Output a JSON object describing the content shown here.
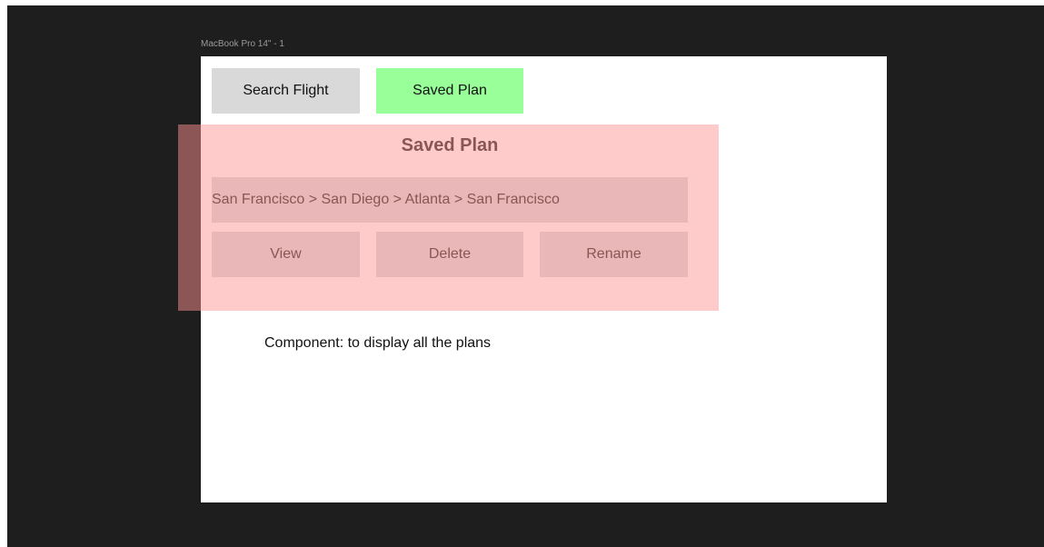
{
  "canvas": {
    "frame_label": "MacBook Pro 14\" - 1"
  },
  "nav": {
    "search_flight_label": "Search Flight",
    "saved_plan_label": "Saved Plan"
  },
  "saved_plan_panel": {
    "title": "Saved Plan",
    "route": "San Francisco > San Diego > Atlanta > San Francisco",
    "actions": {
      "view_label": "View",
      "delete_label": "Delete",
      "rename_label": "Rename"
    }
  },
  "annotation": {
    "text": "Component: to display all the plans"
  },
  "colors": {
    "canvas_background": "#1e1e1e",
    "frame_background": "#ffffff",
    "search_button": "#d9d9d9",
    "saved_button_active": "#99ff99",
    "panel_background": "#ffcaca",
    "panel_edge": "#8c5656",
    "panel_item": "#e9b7b7",
    "panel_text": "#8a5555"
  }
}
